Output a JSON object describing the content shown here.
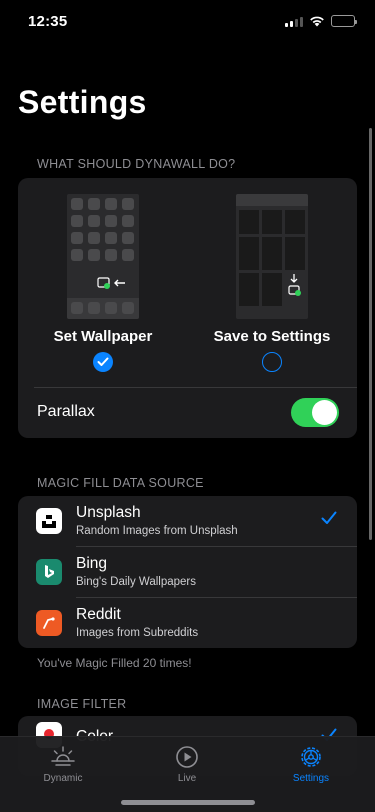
{
  "status": {
    "time": "12:35"
  },
  "title": "Settings",
  "wallpaper_section": {
    "header": "WHAT SHOULD DYNAWALL DO?",
    "options": [
      {
        "label": "Set Wallpaper",
        "selected": true
      },
      {
        "label": "Save to Settings",
        "selected": false
      }
    ],
    "parallax": {
      "label": "Parallax",
      "enabled": true
    }
  },
  "source_section": {
    "header": "MAGIC FILL DATA SOURCE",
    "items": [
      {
        "title": "Unsplash",
        "subtitle": "Random Images from Unsplash",
        "icon": "unsplash-icon",
        "color": "#ffffff",
        "selected": true
      },
      {
        "title": "Bing",
        "subtitle": "Bing's Daily Wallpapers",
        "icon": "bing-icon",
        "color": "#1a8a6e",
        "selected": false
      },
      {
        "title": "Reddit",
        "subtitle": "Images from Subreddits",
        "icon": "reddit-icon",
        "color": "#ee5a24",
        "selected": false
      }
    ],
    "footer": "You've Magic Filled 20 times!"
  },
  "filter_section": {
    "header": "IMAGE FILTER",
    "items": [
      {
        "title": "Color",
        "icon": "color-filter-icon",
        "selected": true
      }
    ]
  },
  "tab_bar": {
    "tabs": [
      {
        "label": "Dynamic",
        "icon": "sunrise-icon",
        "active": false
      },
      {
        "label": "Live",
        "icon": "play-circle-icon",
        "active": false
      },
      {
        "label": "Settings",
        "icon": "gear-icon",
        "active": true
      }
    ]
  },
  "colors": {
    "accent": "#0a84ff",
    "toggle_on": "#30d158",
    "background": "#000000",
    "card": "#1c1c1e"
  }
}
